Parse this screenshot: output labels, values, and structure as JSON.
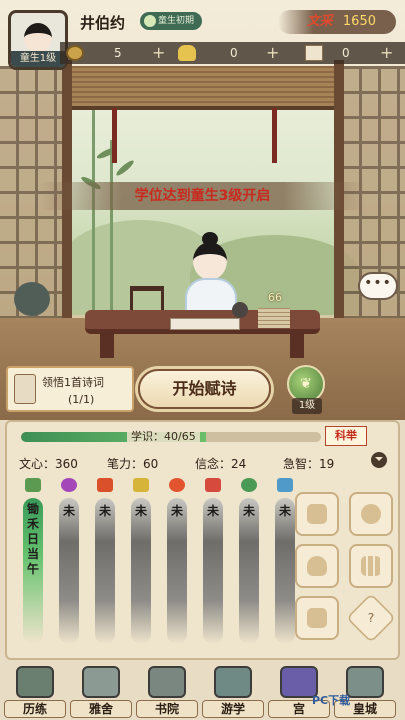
{
  "header": {
    "rank_tag": "童生1级",
    "player_name": "井伯约",
    "stage_pill": "童生初期",
    "wencai_label": "文采",
    "wencai_value": "1650"
  },
  "resources": [
    {
      "icon": "coin-icon",
      "value": "5"
    },
    {
      "icon": "gold-ingot-icon",
      "value": "0"
    },
    {
      "icon": "ticket-icon",
      "value": "0"
    }
  ],
  "banner": {
    "text": "学位达到童生3级开启"
  },
  "scene": {
    "paper_stack_count": "66",
    "chat_bubble": "•••"
  },
  "task": {
    "title": "领悟1首诗词",
    "progress": "(1/1)"
  },
  "actions": {
    "start_button": "开始赋诗",
    "level_badge": "1级"
  },
  "study": {
    "xp_label": "学识：40/65",
    "xp_progress": 0.615,
    "exam_button": "科举",
    "stats": [
      {
        "label": "文心：360"
      },
      {
        "label": "笔力：60"
      },
      {
        "label": "信念：24"
      },
      {
        "label": "急智：19"
      }
    ],
    "columns": [
      {
        "icon": "brush-icon",
        "text": "锄禾日当午",
        "active": true
      },
      {
        "icon": "heart-icon",
        "text": "未"
      },
      {
        "icon": "flag-icon",
        "text": "未"
      },
      {
        "icon": "boat-icon",
        "text": "未"
      },
      {
        "icon": "lotus-icon",
        "text": "未"
      },
      {
        "icon": "tower-icon",
        "text": "未"
      },
      {
        "icon": "cup-icon",
        "text": "未"
      },
      {
        "icon": "mountain-icon",
        "text": "未"
      }
    ]
  },
  "nav": [
    {
      "icon": "journey-icon",
      "label": "历练"
    },
    {
      "icon": "residence-icon",
      "label": "雅舍"
    },
    {
      "icon": "academy-icon",
      "label": "书院"
    },
    {
      "icon": "travel-icon",
      "label": "游学"
    },
    {
      "icon": "palace-icon",
      "label": "宫"
    },
    {
      "icon": "emperor-icon",
      "label": "皇城"
    }
  ],
  "watermark": "PC下载"
}
